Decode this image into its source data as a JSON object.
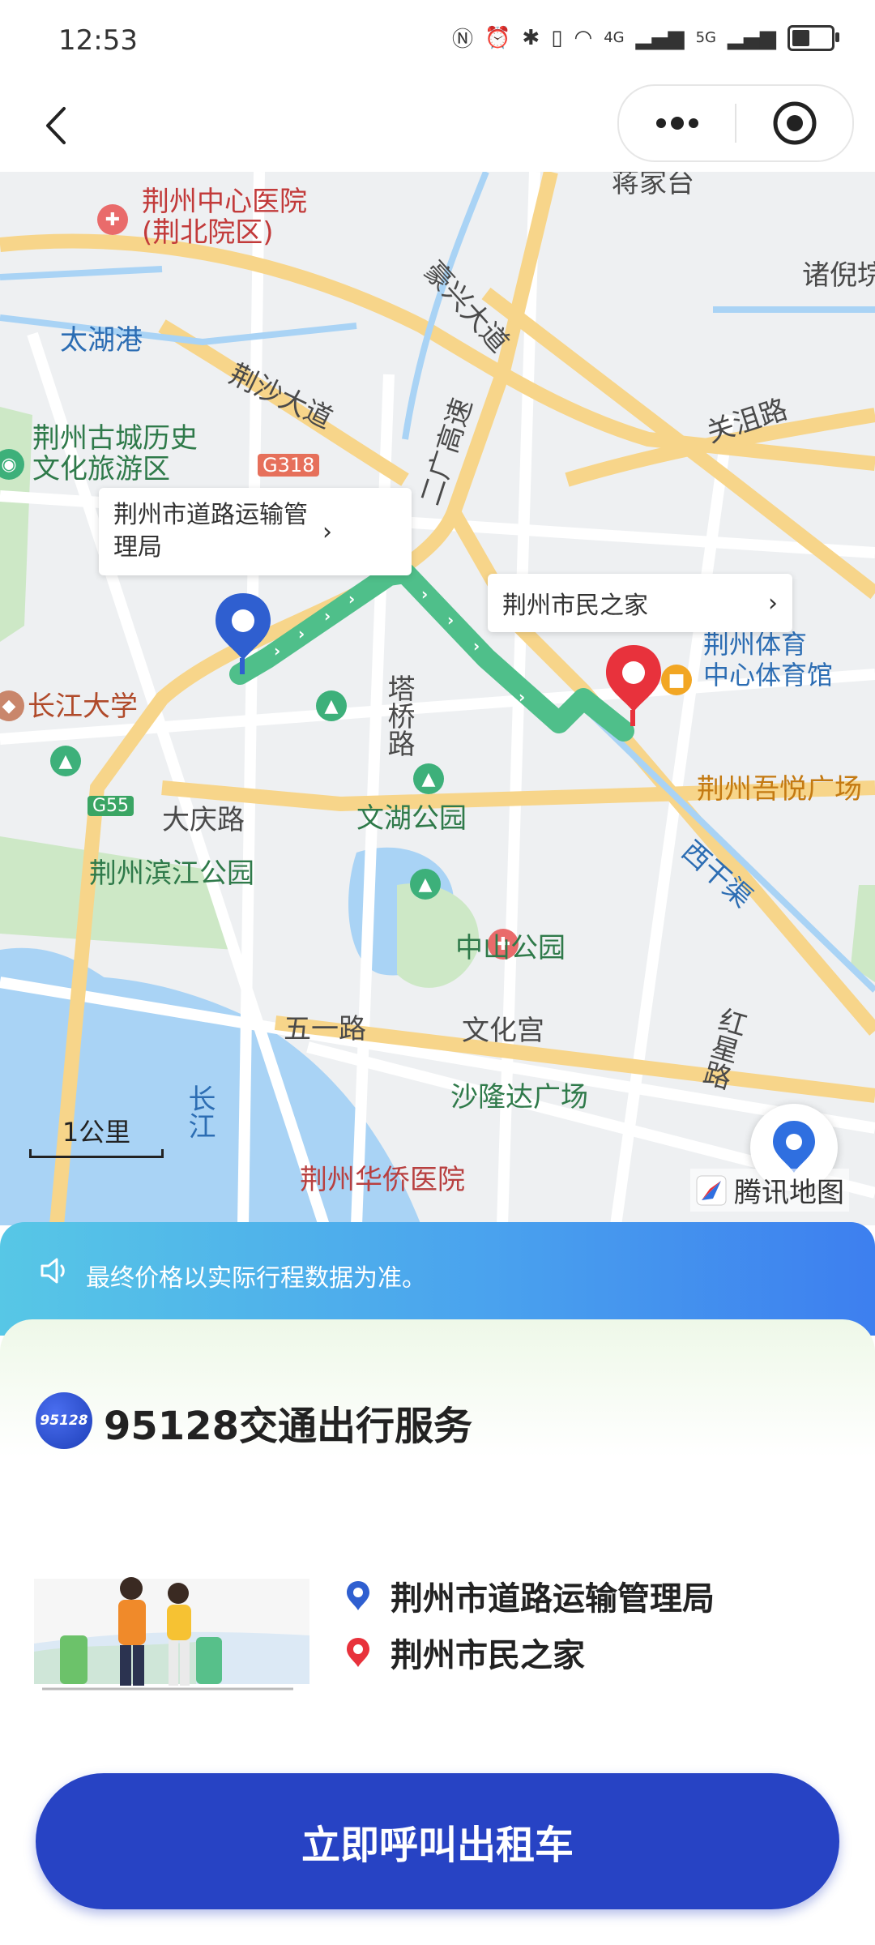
{
  "status": {
    "time": "12:53",
    "net_4g": "4G",
    "net_5g": "5G",
    "battery_level": 0.45
  },
  "titlebar": {
    "back_icon": "chevron-left-icon",
    "more_icon": "more-dots-icon",
    "close_icon": "target-close-icon"
  },
  "map": {
    "labels": {
      "hospital_central": "荆州中心医院\n(荆北院区)",
      "taihu": "太湖港",
      "jingsha_road": "荆沙大道",
      "ancient_city": "荆州古城历史\n文化旅游区",
      "g318": "G318",
      "expressway": "二广高速",
      "xingbei_road": "豪兴大道",
      "guanju_road": "关沮路",
      "zhuni": "诸倪垸",
      "jiangjiatai": "蒋家台",
      "yangtze_university": "长江大学",
      "taqiao_road": "塔桥路",
      "sports_center": "荆州体育\n中心体育馆",
      "wuyue_plaza": "荆州吾悦广场",
      "g55": "G55",
      "daqing_road": "大庆路",
      "wenhu_park": "文湖公园",
      "binjiang_park": "荆州滨江公园",
      "xigan_canal": "西干渠",
      "zhongshan_park": "中山公园",
      "wuyi_road": "五一路",
      "wenhua_palace": "文化宫",
      "hongxing_road": "红星路",
      "shalongda": "沙隆达广场",
      "yangtze_river": "长江",
      "huaqiao_hospital": "荆州华侨医院",
      "map_brand": "腾讯地图"
    },
    "origin_callout": "荆州市道路运输管\n理局",
    "destination_callout": "荆州市民之家",
    "scale": "1公里",
    "locate_icon": "locate-pin-icon"
  },
  "notice": {
    "icon": "speaker-icon",
    "text": "最终价格以实际行程数据为准。"
  },
  "service": {
    "logo_text": "95128",
    "title": "95128交通出行服务"
  },
  "route": {
    "origin": "荆州市道路运输管理局",
    "destination": "荆州市民之家"
  },
  "cta": {
    "label": "立即呼叫出租车"
  },
  "colors": {
    "route": "#4fbf8a",
    "origin_pin": "#2f5fd0",
    "destination_pin": "#e8323c",
    "button": "#2743c4",
    "notice_gradient_start": "#57c7e6",
    "notice_gradient_end": "#3d7fef"
  }
}
